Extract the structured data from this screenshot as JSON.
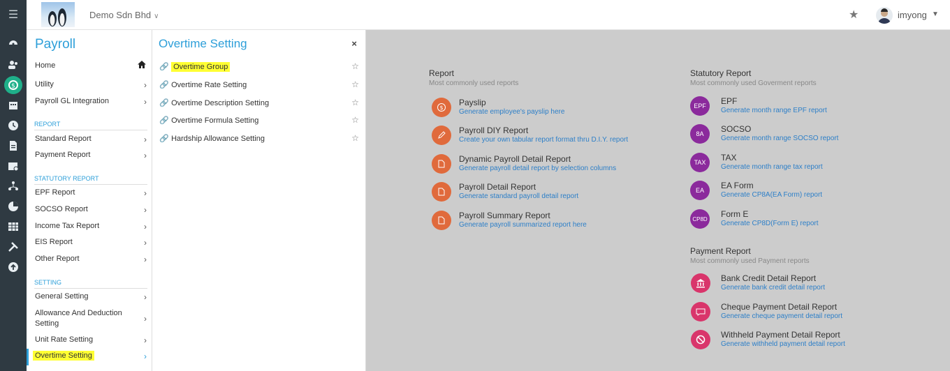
{
  "colors": {
    "accent": "#2d9fd9",
    "rail_bg": "#2f3a42",
    "content_bg": "#cccccc",
    "highlight": "#ffff33",
    "report_icon": "#e06a3c",
    "statutory_icon": "#8b2a9c",
    "payment_icon": "#d9356b",
    "active_rail": "#1fb08a"
  },
  "header": {
    "company": "Demo Sdn Bhd",
    "username": "imyong"
  },
  "rail": {
    "icons": [
      "menu-icon",
      "dashboard-icon",
      "people-icon",
      "payroll-icon",
      "calendar-icon",
      "clock-icon",
      "document-icon",
      "schedule-icon",
      "hierarchy-icon",
      "pie-chart-icon",
      "table-icon",
      "tools-icon",
      "upload-icon"
    ]
  },
  "menu": {
    "title": "Payroll",
    "home": "Home",
    "utility": "Utility",
    "gl": "Payroll GL Integration",
    "report_section": "REPORT",
    "standard_report": "Standard Report",
    "payment_report": "Payment Report",
    "statutory_section": "STATUTORY REPORT",
    "epf_report": "EPF Report",
    "socso_report": "SOCSO Report",
    "income_tax_report": "Income Tax Report",
    "eis_report": "EIS Report",
    "other_report": "Other Report",
    "setting_section": "SETTING",
    "general_setting": "General Setting",
    "allowance_line1": "Allowance And Deduction",
    "allowance_line2": "Setting",
    "unit_rate_setting": "Unit Rate Setting",
    "overtime_setting": "Overtime Setting"
  },
  "submenu": {
    "title": "Overtime Setting",
    "items": [
      "Overtime Group",
      "Overtime Rate Setting",
      "Overtime Description Setting",
      "Overtime Formula Setting",
      "Hardship Allowance Setting"
    ]
  },
  "report": {
    "heading": "Report",
    "subheading": "Most commonly used reports",
    "items": [
      {
        "title": "Payslip",
        "desc": "Generate employee's payslip here"
      },
      {
        "title": "Payroll DIY Report",
        "desc": "Create your own tabular report format thru D.I.Y. report"
      },
      {
        "title": "Dynamic Payroll Detail Report",
        "desc": "Generate payroll detail report by selection columns"
      },
      {
        "title": "Payroll Detail Report",
        "desc": "Generate standard payroll detail report"
      },
      {
        "title": "Payroll Summary Report",
        "desc": "Generate payroll summarized report here"
      }
    ]
  },
  "statutory": {
    "heading": "Statutory Report",
    "subheading": "Most commonly used Goverment reports",
    "items": [
      {
        "badge": "EPF",
        "title": "EPF",
        "desc": "Generate month range EPF report"
      },
      {
        "badge": "8A",
        "title": "SOCSO",
        "desc": "Generate month range SOCSO report"
      },
      {
        "badge": "TAX",
        "title": "TAX",
        "desc": "Generate month range tax report"
      },
      {
        "badge": "EA",
        "title": "EA Form",
        "desc": "Generate CP8A(EA Form) report"
      },
      {
        "badge": "CP8D",
        "title": "Form E",
        "desc": "Generate CP8D(Form E) report"
      }
    ]
  },
  "payment": {
    "heading": "Payment Report",
    "subheading": "Most commonly used Payment reports",
    "items": [
      {
        "title": "Bank Credit Detail Report",
        "desc": "Generate bank credit detail report"
      },
      {
        "title": "Cheque Payment Detail Report",
        "desc": "Generate cheque payment detail report"
      },
      {
        "title": "Withheld Payment Detail Report",
        "desc": "Generate withheld payment detail report"
      }
    ]
  }
}
